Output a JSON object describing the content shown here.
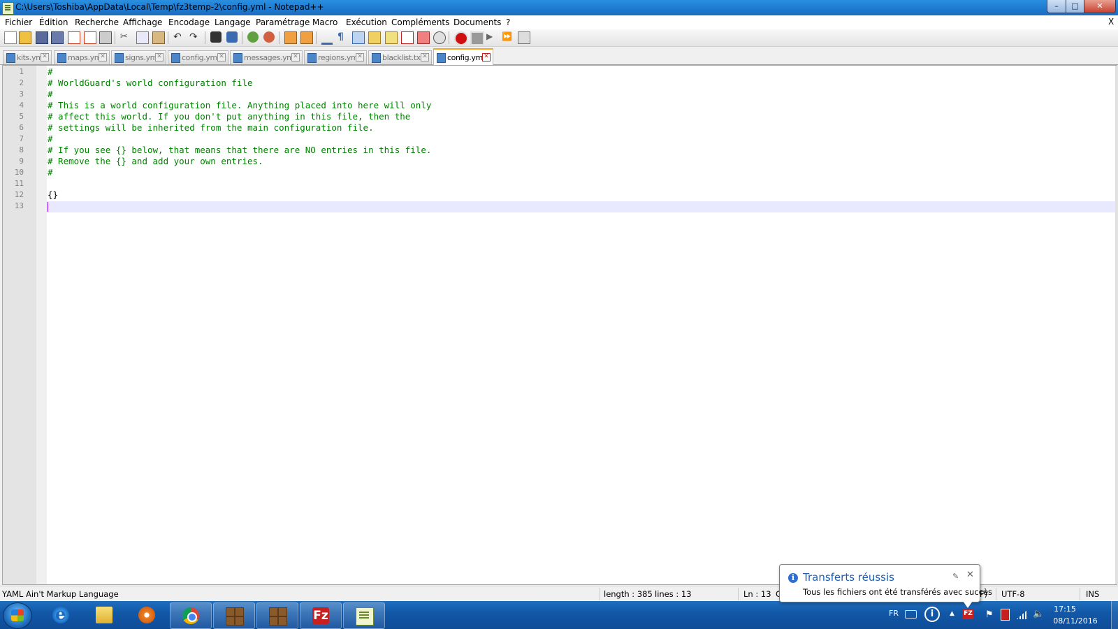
{
  "window": {
    "title": "C:\\Users\\Toshiba\\AppData\\Local\\Temp\\fz3temp-2\\config.yml - Notepad++",
    "min_label": "–",
    "max_label": "□",
    "close_label": "✕"
  },
  "menu": {
    "items": [
      "Fichier",
      "Édition",
      "Recherche",
      "Affichage",
      "Encodage",
      "Langage",
      "Paramétrage",
      "Macro",
      "Exécution",
      "Compléments",
      "Documents",
      "?"
    ],
    "close_label": "X"
  },
  "toolbar": {
    "icons": [
      "new-file-icon",
      "open-file-icon",
      "save-icon",
      "save-all-icon",
      "close-icon",
      "close-all-icon",
      "print-icon",
      "cut-icon",
      "copy-icon",
      "paste-icon",
      "undo-icon",
      "redo-icon",
      "find-icon",
      "replace-icon",
      "zoom-in-icon",
      "zoom-out-icon",
      "sync-vertical-icon",
      "sync-horizontal-icon",
      "word-wrap-icon",
      "show-all-chars-icon",
      "indent-guide-icon",
      "udl-icon",
      "function-list-icon",
      "doc-map-icon",
      "folder-workspace-icon",
      "monitoring-icon",
      "record-macro-icon",
      "stop-record-icon",
      "play-macro-icon",
      "run-macro-multiple-icon",
      "save-macro-icon"
    ]
  },
  "tabs": [
    {
      "label": "kits.yml",
      "active": false
    },
    {
      "label": "maps.yml",
      "active": false
    },
    {
      "label": "signs.yml",
      "active": false
    },
    {
      "label": "config.yml",
      "active": false
    },
    {
      "label": "messages.yml",
      "active": false
    },
    {
      "label": "regions.yml",
      "active": false
    },
    {
      "label": "blacklist.txt",
      "active": false
    },
    {
      "label": "config.yml",
      "active": true
    }
  ],
  "editor": {
    "lines": [
      {
        "num": "1",
        "text": "#"
      },
      {
        "num": "2",
        "text": "# WorldGuard's world configuration file"
      },
      {
        "num": "3",
        "text": "#"
      },
      {
        "num": "4",
        "text": "# This is a world configuration file. Anything placed into here will only"
      },
      {
        "num": "5",
        "text": "# affect this world. If you don't put anything in this file, then the"
      },
      {
        "num": "6",
        "text": "# settings will be inherited from the main configuration file."
      },
      {
        "num": "7",
        "text": "#"
      },
      {
        "num": "8",
        "text": "# If you see {} below, that means that there are NO entries in this file."
      },
      {
        "num": "9",
        "text": "# Remove the {} and add your own entries."
      },
      {
        "num": "10",
        "text": "#"
      },
      {
        "num": "11",
        "text": ""
      },
      {
        "num": "12",
        "text": "{}"
      },
      {
        "num": "13",
        "text": ""
      }
    ],
    "comment_color": "#008000",
    "current_line_color": "#e8e8ff"
  },
  "status": {
    "language": "YAML Ain't Markup Language",
    "length": "length : 385",
    "lines": "lines : 13",
    "position": "Ln : 13",
    "position_cut": "C",
    "eol_cut": "F)",
    "encoding": "UTF-8",
    "mode": "INS"
  },
  "notification": {
    "title": "Transferts réussis",
    "text": "Tous les fichiers ont été transférés avec succès",
    "close_label": "✕",
    "pin_label": "✎"
  },
  "taskbar": {
    "apps": [
      "internet-explorer-icon",
      "windows-explorer-icon",
      "media-player-icon",
      "chrome-icon",
      "minecraft-icon",
      "minecraft-icon",
      "filezilla-icon",
      "notepadpp-icon"
    ],
    "filezilla_label": "Fz",
    "ie_letter": "e",
    "tray": {
      "lang": "FR",
      "assist_label": "i",
      "arrow": "▲",
      "fz_label": "FZ",
      "flag": "⚑",
      "vol": "🔈",
      "time": "17:15",
      "date": "08/11/2016"
    }
  },
  "colors": {
    "titlebar": "#1f7bd0",
    "taskbar": "#1258a8",
    "active_tab_accent": "#f5a623",
    "notification_title": "#1e5fb4"
  }
}
